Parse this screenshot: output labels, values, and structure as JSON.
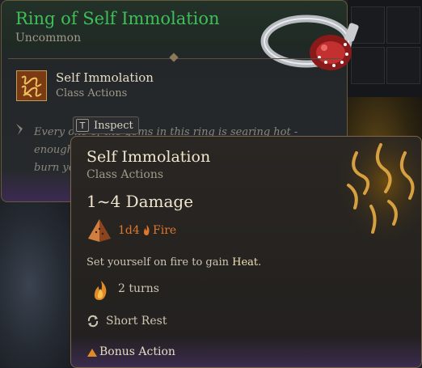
{
  "item": {
    "title": "Ring of Self Immolation",
    "rarity": "Uncommon",
    "action_name": "Self Immolation",
    "action_category": "Class Actions",
    "lore_line1": "Every one of the gems in this ring is searing hot - enough to",
    "lore_line2": "burn you",
    "colors": {
      "rarity_green": "#3fbf5a"
    }
  },
  "inspect": {
    "key": "T",
    "label": "Inspect"
  },
  "spell": {
    "title": "Self Immolation",
    "category": "Class Actions",
    "damage": "1~4 Damage",
    "dice": "1d4",
    "damage_type": "Fire",
    "desc_prefix": "Set yourself on fire to gain ",
    "desc_keyword": "Heat",
    "desc_suffix": ".",
    "duration": "2 turns",
    "recharge": "Short Rest",
    "action_type": "Bonus Action",
    "colors": {
      "fire_orange": "#e0762a"
    }
  }
}
